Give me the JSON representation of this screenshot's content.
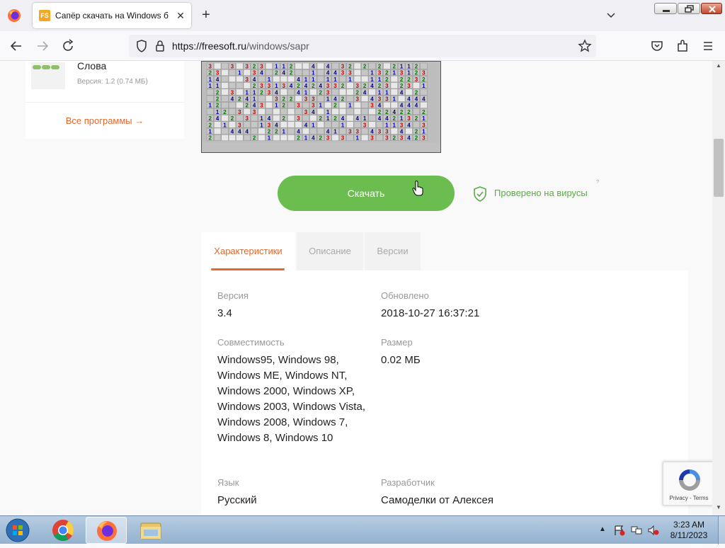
{
  "browser": {
    "tab_title": "Сапёр скачать на Windows бе",
    "tab_favicon_text": "FS",
    "url_host": "https://freesoft.ru",
    "url_path": "/windows/sapr"
  },
  "sidebar": {
    "program_name": "Слова",
    "program_version": "Версия: 1.2 (0.74 МБ)",
    "all_programs": "Все программы →"
  },
  "download": {
    "button_label": "Скачать",
    "verified_label": "Проверено на вирусы",
    "verified_help": "?"
  },
  "tabs": [
    {
      "label": "Характеристики",
      "active": true
    },
    {
      "label": "Описание",
      "active": false
    },
    {
      "label": "Версии",
      "active": false
    }
  ],
  "specs": {
    "version_label": "Версия",
    "version_value": "3.4",
    "updated_label": "Обновлено",
    "updated_value": "2018-10-27 16:37:21",
    "compat_label": "Совместимость",
    "compat_value": "Windows95, Windows 98, Windows ME, Windows NT, Windows 2000, Windows XP, Windows 2003, Windows Vista, Windows 2008, Windows 7, Windows 8, Windows 10",
    "size_label": "Размер",
    "size_value": "0.02 МБ",
    "lang_label": "Язык",
    "lang_value": "Русский",
    "dev_label": "Разработчик",
    "dev_value": "Самоделки от Алексея"
  },
  "recaptcha": {
    "text": "Privacy - Terms"
  },
  "taskbar": {
    "time": "3:23 AM",
    "date": "8/11/2023"
  },
  "colors": {
    "accent_orange": "#e8662a",
    "download_green": "#6bbd4f",
    "verified_green": "#5ea94a"
  }
}
